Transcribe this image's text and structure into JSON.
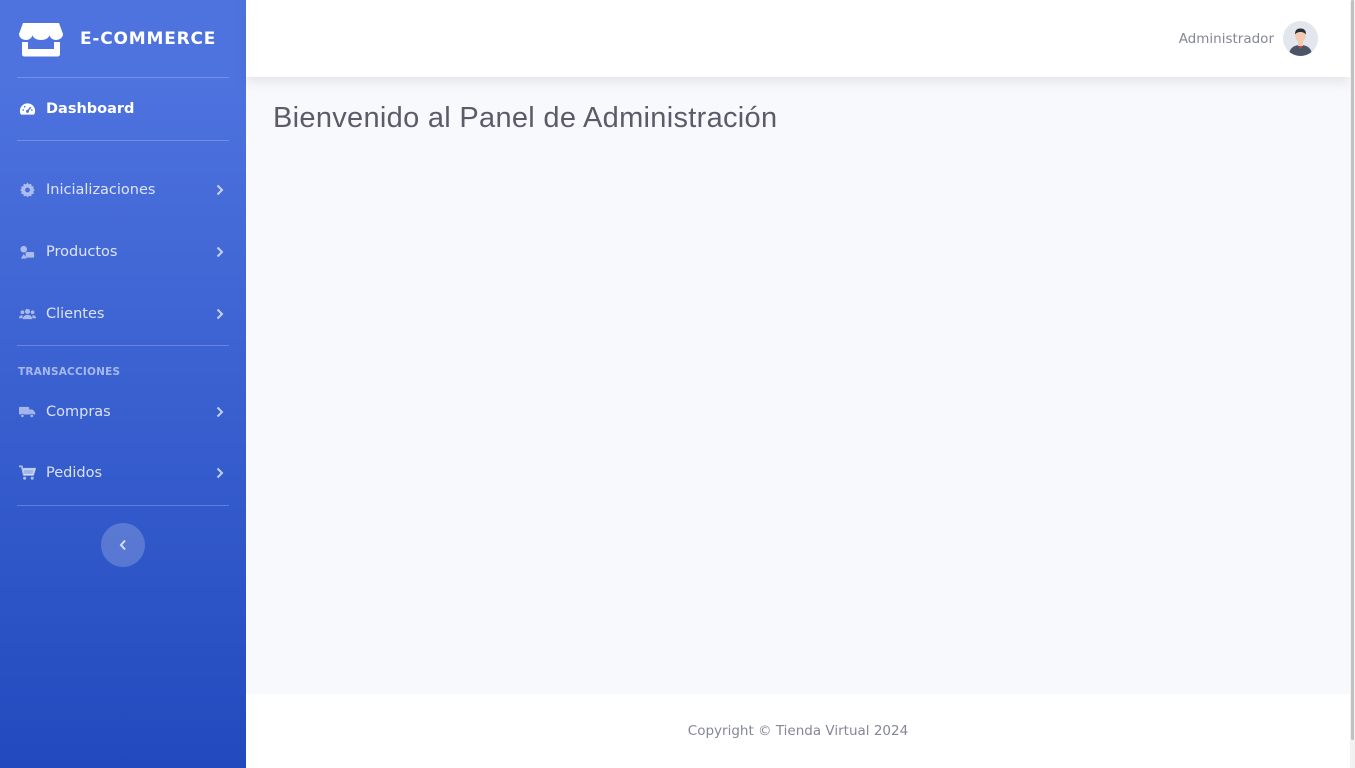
{
  "sidebar": {
    "brand": {
      "text": "E-COMMERCE",
      "icon": "store-icon"
    },
    "items": [
      {
        "label": "Dashboard",
        "icon": "tachometer-icon",
        "active": true
      },
      {
        "label": "Inicializaciones",
        "icon": "gear-icon"
      },
      {
        "label": "Productos",
        "icon": "shapes-icon"
      },
      {
        "label": "Clientes",
        "icon": "users-icon"
      },
      {
        "label": "Compras",
        "icon": "truck-icon"
      },
      {
        "label": "Pedidos",
        "icon": "cart-icon"
      }
    ],
    "heading": "TRANSACCIONES",
    "toggle_icon": "chevron-left-icon"
  },
  "topbar": {
    "user_name": "Administrador",
    "avatar_icon": "user-avatar"
  },
  "main": {
    "title": "Bienvenido al Panel de Administración"
  },
  "footer": {
    "copyright": "Copyright © Tienda Virtual 2024"
  },
  "colors": {
    "sidebar_top": "#4e73df",
    "sidebar_bottom": "#224abe",
    "background": "#f8f9fc",
    "text_muted": "#858796",
    "title": "#5a5c69"
  }
}
